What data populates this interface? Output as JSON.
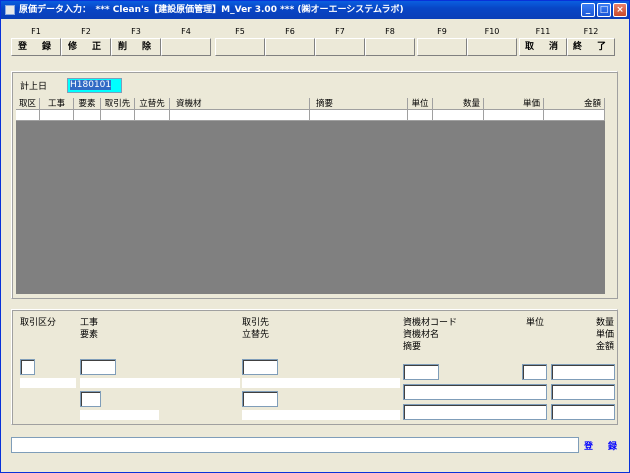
{
  "window": {
    "title": "原価データ入力：　*** Clean's【建設原価管理】M_Ver 3.00 *** (㈱オーエーシステムラボ)",
    "minimize_glyph": "_",
    "maximize_glyph": "□",
    "close_glyph": "×"
  },
  "fkeys": [
    {
      "key": "F1",
      "label": "登　録"
    },
    {
      "key": "F2",
      "label": "修　正"
    },
    {
      "key": "F3",
      "label": "削　除"
    },
    {
      "key": "F4",
      "label": ""
    },
    {
      "key": "F5",
      "label": ""
    },
    {
      "key": "F6",
      "label": ""
    },
    {
      "key": "F7",
      "label": ""
    },
    {
      "key": "F8",
      "label": ""
    },
    {
      "key": "F9",
      "label": ""
    },
    {
      "key": "F10",
      "label": ""
    },
    {
      "key": "F11",
      "label": "取　消"
    },
    {
      "key": "F12",
      "label": "終　了"
    }
  ],
  "form": {
    "date_label": "計上日",
    "date_value": "H180101"
  },
  "grid": {
    "columns": [
      "取区",
      "工事",
      "要素",
      "取引先",
      "立替先",
      "資機材",
      "摘要",
      "単位",
      "数量",
      "単価",
      "金額"
    ],
    "background": "#808080"
  },
  "detail": {
    "torihiki_kubun": "取引区分",
    "koji": "工事",
    "yoso": "要素",
    "torihikisaki": "取引先",
    "tatekaesaki": "立替先",
    "shikizai_code": "資機材コード",
    "shikizai_name": "資機材名",
    "tekiyo": "摘要",
    "tani": "単位",
    "suryo": "数量",
    "tanka": "単価",
    "kingaku": "金額"
  },
  "footer": {
    "register_link": "登　録"
  },
  "colors": {
    "titlebar": "#0a46c6",
    "window_bg": "#ece9d8",
    "date_input_bg": "#00ffff",
    "grid_bg": "#808080",
    "link": "#0000ff"
  }
}
